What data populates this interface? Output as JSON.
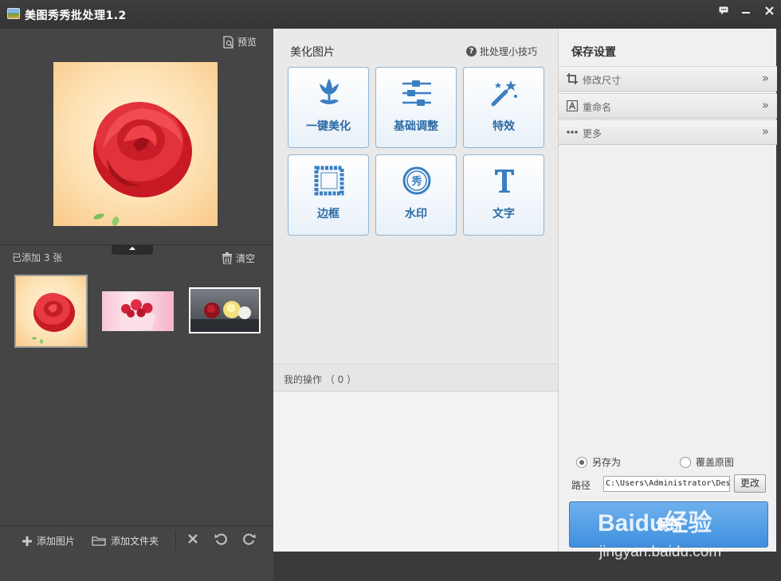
{
  "window": {
    "title": "美图秀秀批处理1.2"
  },
  "left": {
    "preview_label": "预览",
    "added_count": "已添加 3 张",
    "clear_label": "清空",
    "add_image_label": "添加图片",
    "add_folder_label": "添加文件夹"
  },
  "middle": {
    "title": "美化图片",
    "tips_label": "批处理小技巧",
    "tools": [
      {
        "label": "一键美化",
        "icon": "tulip-icon"
      },
      {
        "label": "基础调整",
        "icon": "sliders-icon"
      },
      {
        "label": "特效",
        "icon": "magic-wand-icon"
      },
      {
        "label": "边框",
        "icon": "frame-icon"
      },
      {
        "label": "水印",
        "icon": "watermark-seal-icon"
      },
      {
        "label": "文字",
        "icon": "text-t-icon"
      }
    ],
    "my_operations": "我的操作 （ 0 ）"
  },
  "right": {
    "title": "保存设置",
    "sections": [
      {
        "label": "修改尺寸",
        "icon": "crop-icon"
      },
      {
        "label": "重命名",
        "icon": "rename-a-icon"
      },
      {
        "label": "更多",
        "icon": "more-dots-icon"
      }
    ],
    "save_as_label": "另存为",
    "overwrite_label": "覆盖原图",
    "selected_option": "另存为",
    "path_label": "路径",
    "path_value": "C:\\Users\\Administrator\\Des",
    "change_label": "更改",
    "save_label": "保存"
  },
  "watermark": {
    "brand": "Baidu经验",
    "url": "jingyan.baidu.com"
  },
  "colors": {
    "accent_blue": "#2b6aa5",
    "save_button": "#4a97e2",
    "dark_panel": "#454545"
  }
}
